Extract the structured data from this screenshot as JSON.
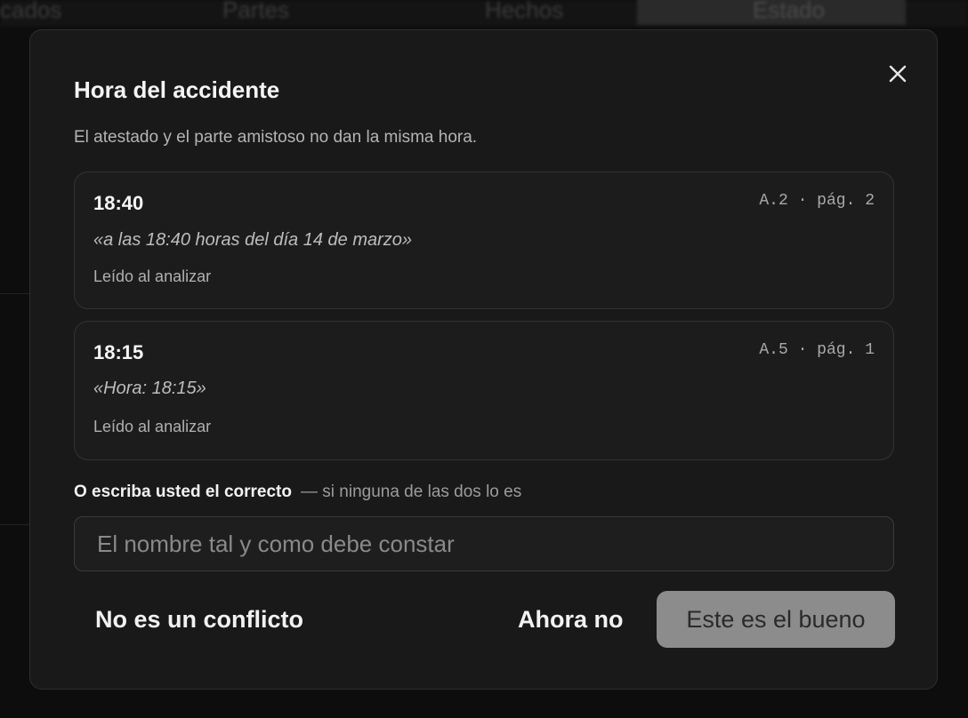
{
  "background": {
    "tabs": [
      "cados",
      "Partes",
      "Hechos",
      "Estado"
    ]
  },
  "dialog": {
    "title": "Hora del accidente",
    "subtitle": "El atestado y el parte amistoso no dan la misma hora.",
    "options": [
      {
        "time": "18:40",
        "ref": "A.2 · pág. 2",
        "quote": "«a las 18:40 horas del día 14 de marzo»",
        "note": "Leído al analizar"
      },
      {
        "time": "18:15",
        "ref": "A.5 · pág. 1",
        "quote": "«Hora: 18:15»",
        "note": "Leído al analizar"
      }
    ],
    "write_label": "O escriba usted el correcto",
    "write_hint": "— si ninguna de las dos lo es",
    "input_placeholder": "El nombre tal y como debe constar",
    "input_value": "",
    "buttons": {
      "not_conflict": "No es un conflicto",
      "not_now": "Ahora no",
      "confirm": "Este es el bueno"
    }
  },
  "colors": {
    "modal_bg": "#191919",
    "primary_button": "#8c8c8c"
  }
}
